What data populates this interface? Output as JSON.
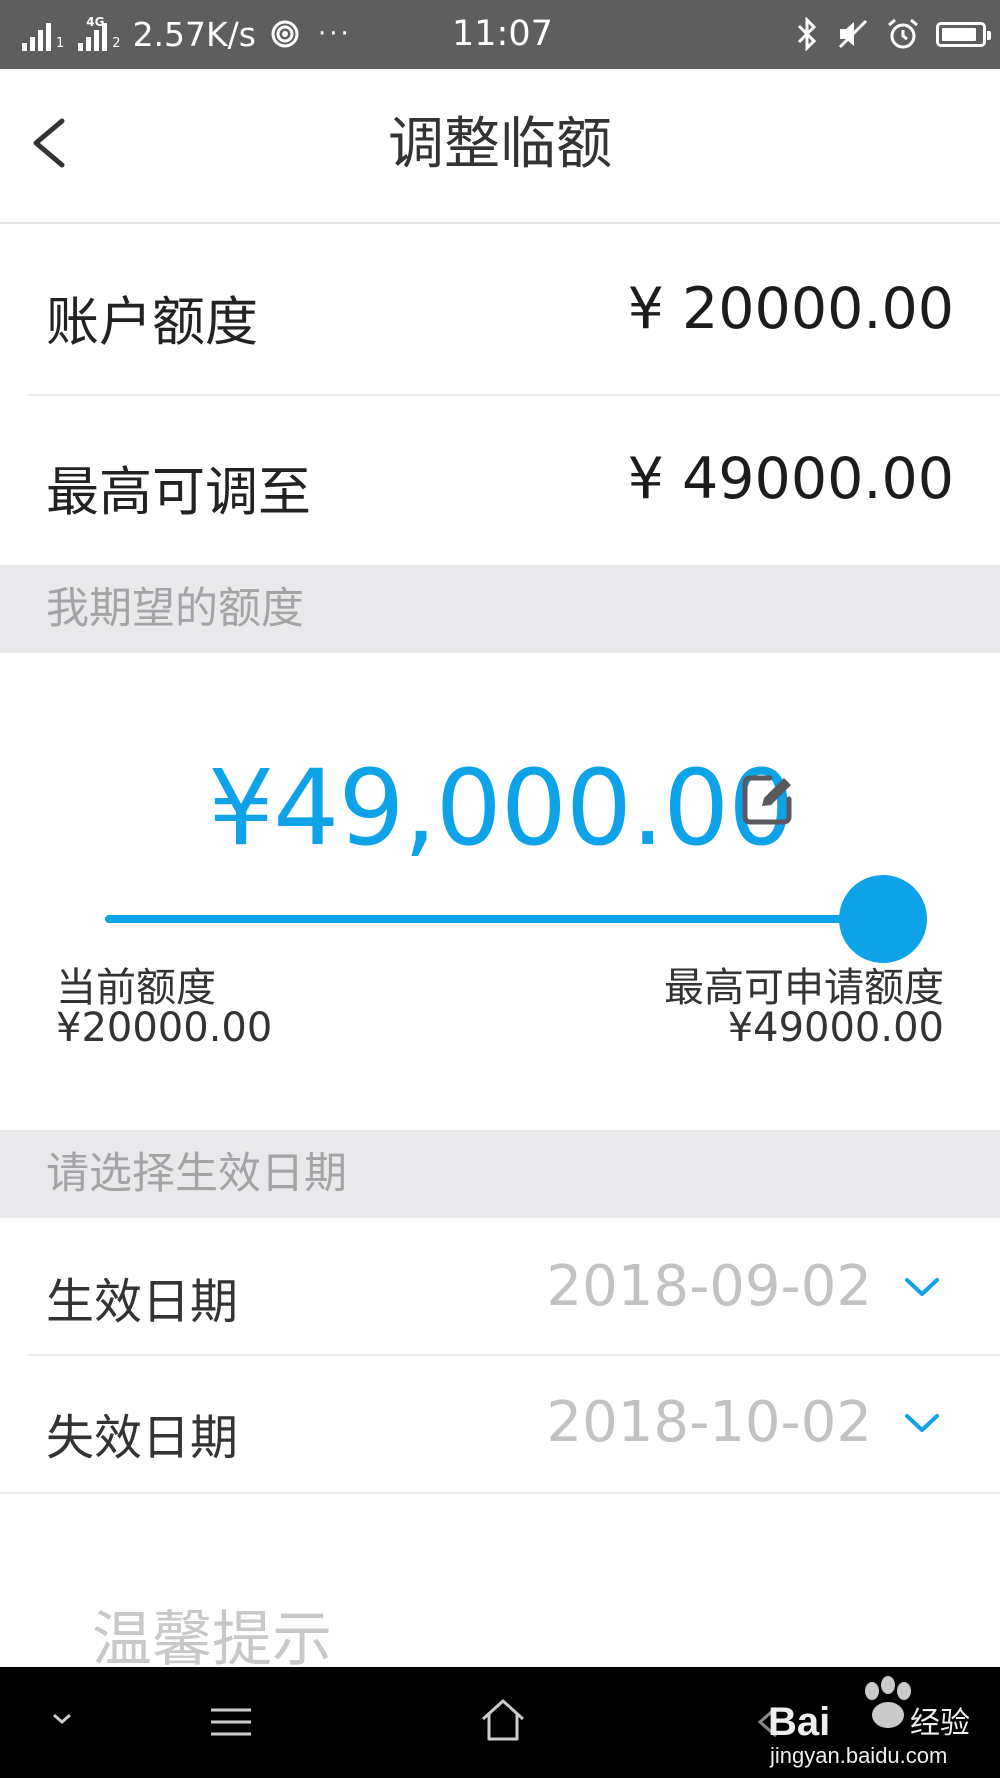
{
  "status_bar": {
    "network_type": "4G",
    "sim1": "1",
    "sim2": "2",
    "speed": "2.57K/s",
    "more": "···",
    "time": "11:07",
    "battery_level": 0.9
  },
  "navbar": {
    "title": "调整临额",
    "back_icon": "chevron-left-icon"
  },
  "credit_limit": {
    "label": "账户额度",
    "value": "¥ 20000.00"
  },
  "max_adjust": {
    "label": "最高可调至",
    "value": "¥ 49000.00"
  },
  "expected_section": {
    "header": "我期望的额度"
  },
  "expected_amount": {
    "value": "¥49,000.00",
    "edit_icon": "edit-icon",
    "slider_position": 1.0,
    "min_label": "当前额度",
    "min_value": "¥20000.00",
    "max_label": "最高可申请额度",
    "max_value": "¥49000.00"
  },
  "date_section": {
    "header": "请选择生效日期"
  },
  "effective_date": {
    "label": "生效日期",
    "value": "2018-09-02",
    "icon": "chevron-down-icon"
  },
  "expire_date": {
    "label": "失效日期",
    "value": "2018-10-02",
    "icon": "chevron-down-icon"
  },
  "tips": {
    "title": "温馨提示"
  },
  "watermark": {
    "brand_text": "Bai",
    "brand_suffix": "经验",
    "url": "jingyan.baidu.com"
  },
  "colors": {
    "accent": "#0ea2e8",
    "section_bg": "#e9e9eb",
    "status_bar": "#5e5e5e"
  }
}
